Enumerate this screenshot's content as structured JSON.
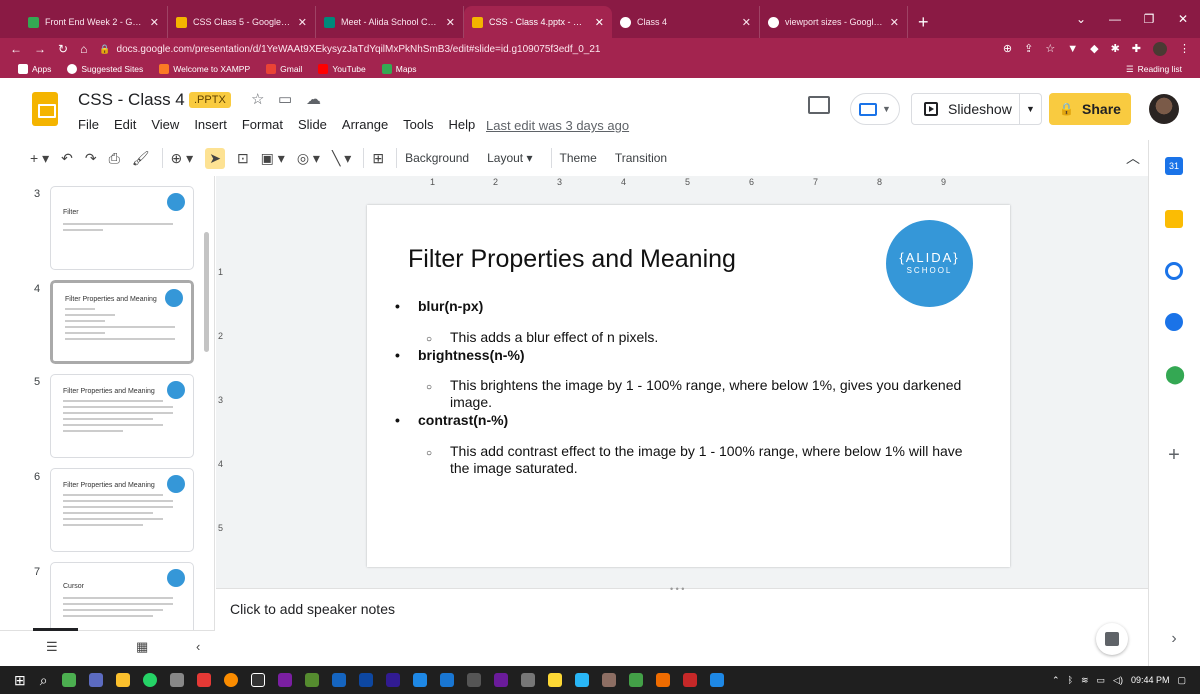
{
  "browser": {
    "tabs": [
      {
        "title": "Front End Week 2 - Google Drive",
        "color": "#34a853",
        "active": false
      },
      {
        "title": "CSS Class 5 - Google Slides",
        "color": "#f4b400",
        "active": false
      },
      {
        "title": "Meet - Alida School Cohort",
        "color": "#00897b",
        "active": false
      },
      {
        "title": "CSS - Class 4.pptx - Google Slides",
        "color": "#f4b400",
        "active": true
      },
      {
        "title": "Class 4",
        "color": "#ffffff",
        "active": false
      },
      {
        "title": "viewport sizes - Google Search",
        "color": "#ffffff",
        "active": false
      }
    ],
    "url": "docs.google.com/presentation/d/1YeWAAt9XEkysyzJaTdYqilMxPkNhSmB3/edit#slide=id.g109075f3edf_0_21",
    "bookmarks": [
      {
        "label": "Apps",
        "color": "#ffffff"
      },
      {
        "label": "Suggested Sites",
        "color": "#ffffff"
      },
      {
        "label": "Welcome to XAMPP",
        "color": "#fb7a24"
      },
      {
        "label": "Gmail",
        "color": "#ea4335"
      },
      {
        "label": "YouTube",
        "color": "#ff0000"
      },
      {
        "label": "Maps",
        "color": "#34a853"
      }
    ],
    "reading_list": "Reading list"
  },
  "app": {
    "title": "CSS - Class 4",
    "badge": ".PPTX",
    "menu": [
      "File",
      "Edit",
      "View",
      "Insert",
      "Format",
      "Slide",
      "Arrange",
      "Tools",
      "Help"
    ],
    "last_edit": "Last edit was 3 days ago",
    "slideshow_label": "Slideshow",
    "share_label": "Share"
  },
  "toolbar": {
    "background": "Background",
    "layout": "Layout",
    "theme": "Theme",
    "transition": "Transition"
  },
  "filmstrip": {
    "slides": [
      {
        "num": "3",
        "title": "Filter",
        "selected": false
      },
      {
        "num": "4",
        "title": "Filter Properties and Meaning",
        "selected": true
      },
      {
        "num": "5",
        "title": "Filter Properties and Meaning",
        "selected": false
      },
      {
        "num": "6",
        "title": "Filter Properties and Meaning",
        "selected": false
      },
      {
        "num": "7",
        "title": "Cursor",
        "selected": false
      }
    ]
  },
  "ruler": {
    "top": [
      "1",
      "2",
      "3",
      "4",
      "5",
      "6",
      "7",
      "8",
      "9"
    ],
    "left": [
      "1",
      "2",
      "3",
      "4",
      "5"
    ]
  },
  "slide": {
    "title": "Filter Properties and Meaning",
    "logo_line1": "{ALIDA}",
    "logo_line2": "SCHOOL",
    "bullets": [
      {
        "heading": "blur(n-px)",
        "desc": "This adds a blur effect of n pixels."
      },
      {
        "heading": "brightness(n-%)",
        "desc": "This brightens the image by 1 - 100% range, where below 1%, gives you darkened image."
      },
      {
        "heading": "contrast(n-%)",
        "desc": "This add contrast effect to the image by 1 - 100% range, where below 1% will have the image saturated."
      }
    ]
  },
  "notes": {
    "placeholder": "Click to add speaker notes"
  },
  "taskbar": {
    "time": "09:44 PM"
  }
}
